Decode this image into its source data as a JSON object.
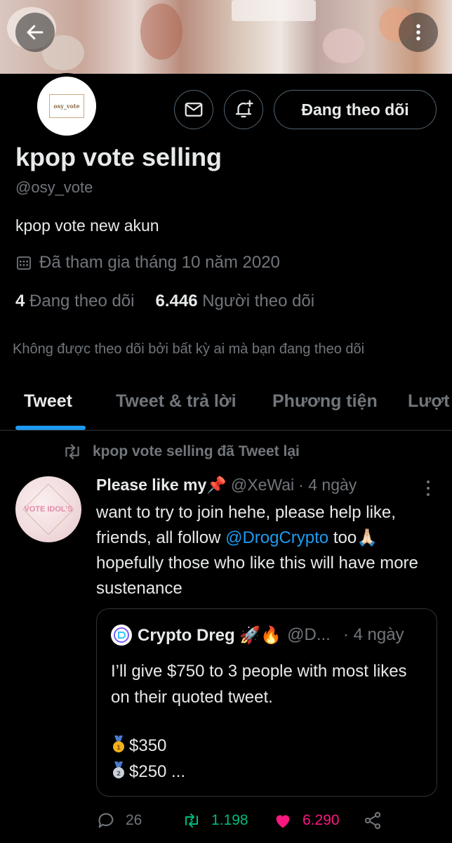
{
  "profile": {
    "name": "kpop vote selling",
    "handle": "@osy_vote",
    "bio": "kpop vote new akun",
    "joined": "Đã tham gia tháng 10 năm 2020",
    "following_count": "4",
    "following_label": "Đang theo dõi",
    "followers_count": "6.446",
    "followers_label": "Người theo dõi",
    "not_followed_notice": "Không được theo dõi bởi bất kỳ ai mà bạn đang theo dõi",
    "avatar_text": "osy_vote"
  },
  "actions": {
    "follow_button": "Đang theo dõi"
  },
  "tabs": [
    {
      "label": "Tweet",
      "active": true
    },
    {
      "label": "Tweet & trả lời",
      "active": false
    },
    {
      "label": "Phương tiện",
      "active": false
    },
    {
      "label": "Lượt",
      "active": false
    }
  ],
  "tweet": {
    "retweeted_by": "kpop vote selling đã Tweet lại",
    "author": "Please like my📌",
    "handle": "@XeWai",
    "time": "· 4 ngày",
    "avatar_text": "VOTE IDOL'S",
    "text_1": "want to try to join hehe, please help like, friends, all follow ",
    "mention": "@DrogCrypto",
    "text_2": " too🙏🏻 hopefully those who like this will have more sustenance",
    "quote": {
      "author": "Crypto Dreg 🚀🔥",
      "handle": "@D...",
      "time": "· 4 ngày",
      "text": "I’ll give $750 to 3 people with most likes on their quoted tweet.",
      "prize_1": "$350",
      "prize_2": "$250 ..."
    },
    "replies": "26",
    "retweets": "1.198",
    "likes": "6.290"
  },
  "colors": {
    "accent": "#1d9bf0",
    "retweet": "#00ba7c",
    "like": "#f91880",
    "muted": "#71767b"
  }
}
